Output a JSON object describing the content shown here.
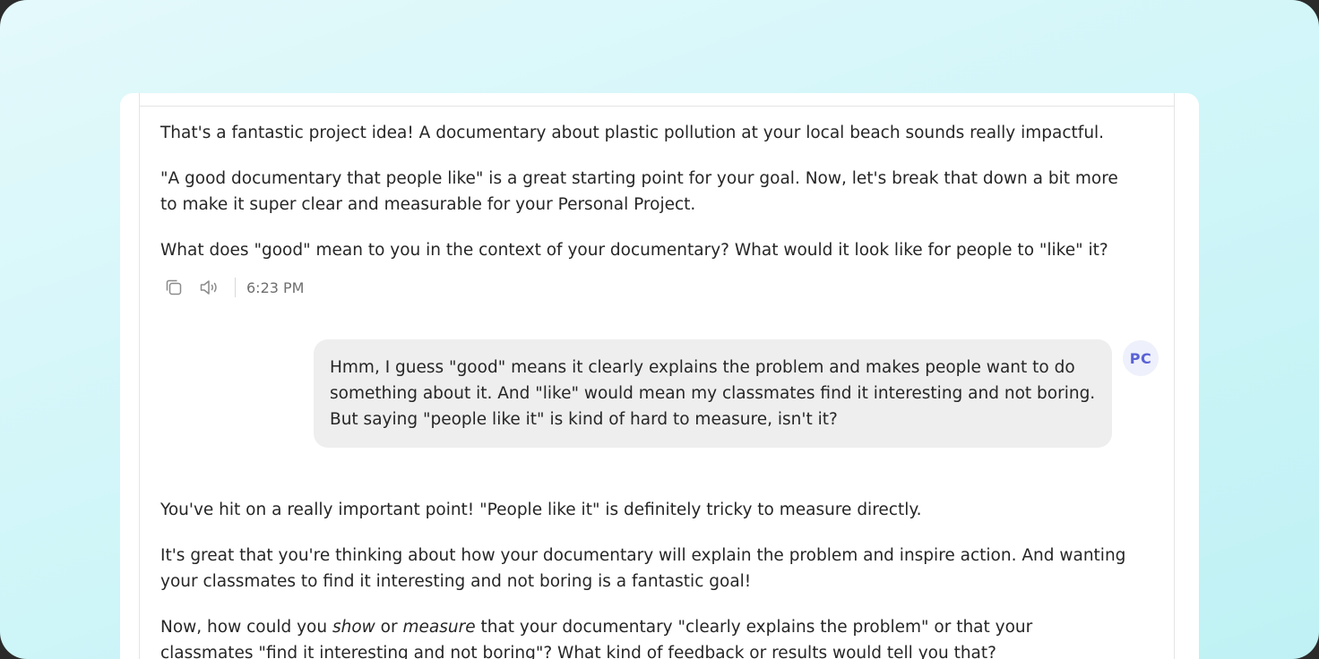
{
  "conversation": {
    "assistant_message_1": {
      "p1": "That's a fantastic project idea! A documentary about plastic pollution at your local beach sounds really impactful.",
      "p2": "\"A good documentary that people like\" is a great starting point for your goal. Now, let's break that down a bit more to make it super clear and measurable for your Personal Project.",
      "p3": "What does \"good\" mean to you in the context of your documentary? What would it look like for people to \"like\" it?"
    },
    "message_actions": {
      "copy_icon": "copy-icon",
      "speaker_icon": "speaker-icon",
      "timestamp": "6:23 PM"
    },
    "user_message": {
      "text": "Hmm, I guess \"good\" means it clearly explains the problem and makes people want to do something about it. And \"like\" would mean my classmates find it interesting and not boring. But saying \"people like it\" is kind of hard to measure, isn't it?",
      "avatar_initials": "PC"
    },
    "assistant_message_2": {
      "p1": "You've hit on a really important point! \"People like it\" is definitely tricky to measure directly.",
      "p2": "It's great that you're thinking about how your documentary will explain the problem and inspire action. And wanting your classmates to find it interesting and not boring is a fantastic goal!",
      "p3_before": "Now, how could you ",
      "p3_em1": "show",
      "p3_mid": " or ",
      "p3_em2": "measure",
      "p3_after": " that your documentary \"clearly explains the problem\" or that your classmates \"find it interesting and not boring\"? What kind of feedback or results would tell you that?"
    }
  },
  "colors": {
    "background_gradient_start": "#e4f9fb",
    "background_gradient_end": "#bff1f4",
    "user_bubble": "#eeeeee",
    "avatar_bg": "#eef0fb",
    "avatar_text": "#5a62d6"
  }
}
